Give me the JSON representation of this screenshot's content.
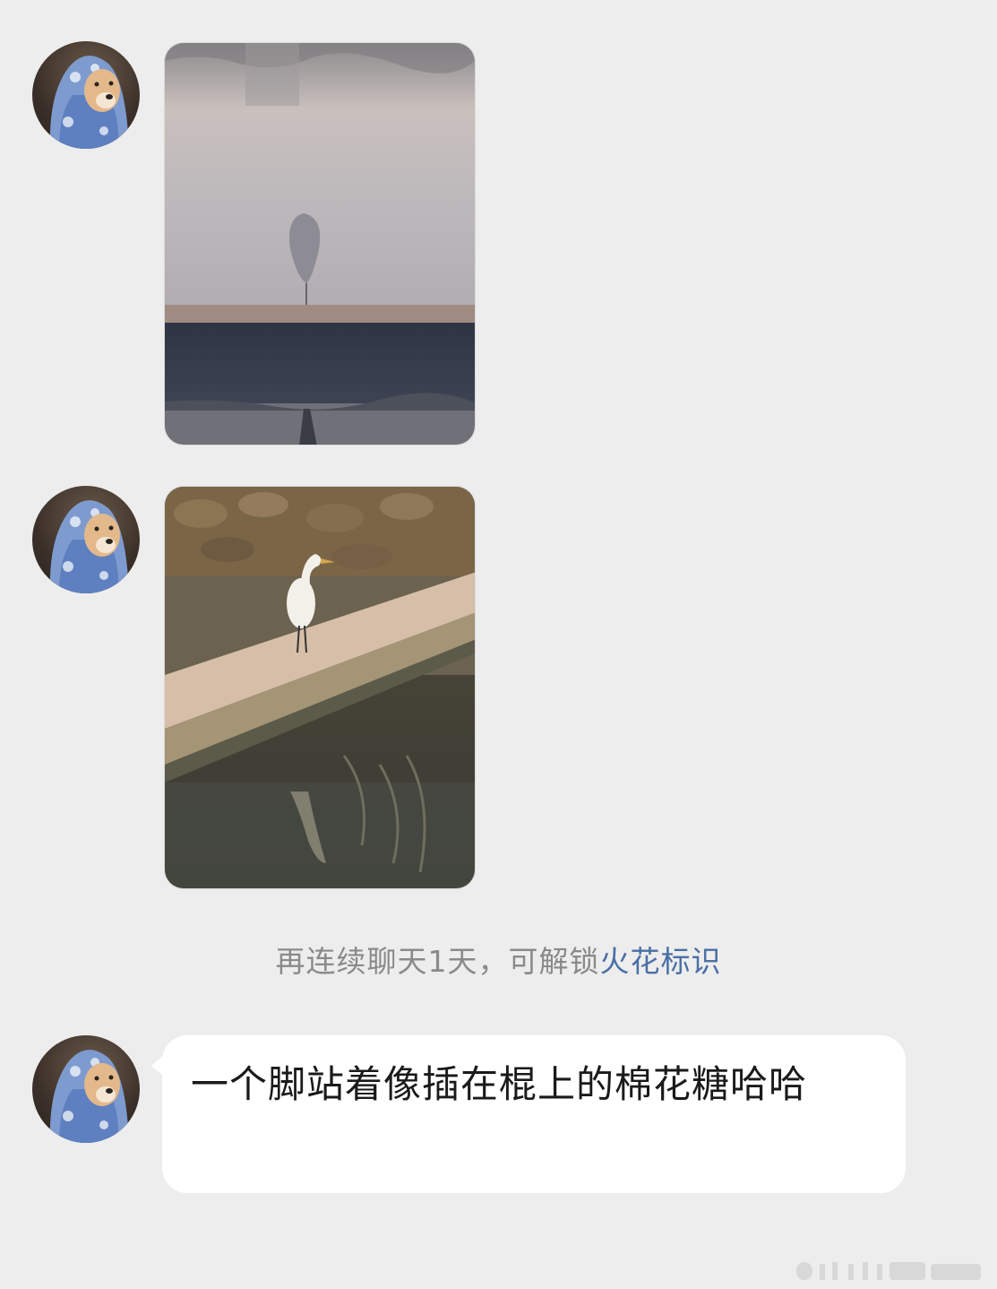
{
  "messages": [
    {
      "type": "image",
      "avatar_icon": "shiba-dog-headscarf-icon",
      "photo_subject": "egret shadow on water"
    },
    {
      "type": "image",
      "avatar_icon": "shiba-dog-headscarf-icon",
      "photo_subject": "egret standing on stone ledge"
    },
    {
      "type": "text",
      "avatar_icon": "shiba-dog-headscarf-icon",
      "text": "一个脚站着像插在棍上的棉花糖哈哈"
    }
  ],
  "system_tip": {
    "prefix": "再连续聊天1天，可解锁",
    "link": "火花标识"
  },
  "colors": {
    "background": "#ededed",
    "bubble": "#ffffff",
    "link": "#4a6fa5",
    "tip_text": "#8a8a8a"
  }
}
